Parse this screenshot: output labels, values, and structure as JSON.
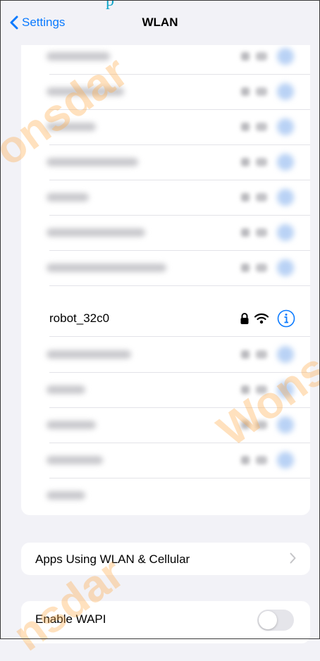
{
  "header": {
    "back_label": "Settings",
    "title": "WLAN",
    "logo_text": "p"
  },
  "networks": {
    "selected": {
      "name": "robot_32c0",
      "secured": true,
      "icons": [
        "lock-icon",
        "wifi-icon",
        "info-icon"
      ]
    }
  },
  "apps_row": {
    "label": "Apps Using WLAN & Cellular",
    "icon": "chevron-right-icon"
  },
  "wapi_row": {
    "label": "Enable WAPI",
    "enabled": false
  },
  "watermarks": [
    "onsdar",
    "Wons",
    "nsdar"
  ],
  "colors": {
    "accent": "#0a7aff",
    "background": "#f2f2f7",
    "watermark": "#ffaa46"
  }
}
